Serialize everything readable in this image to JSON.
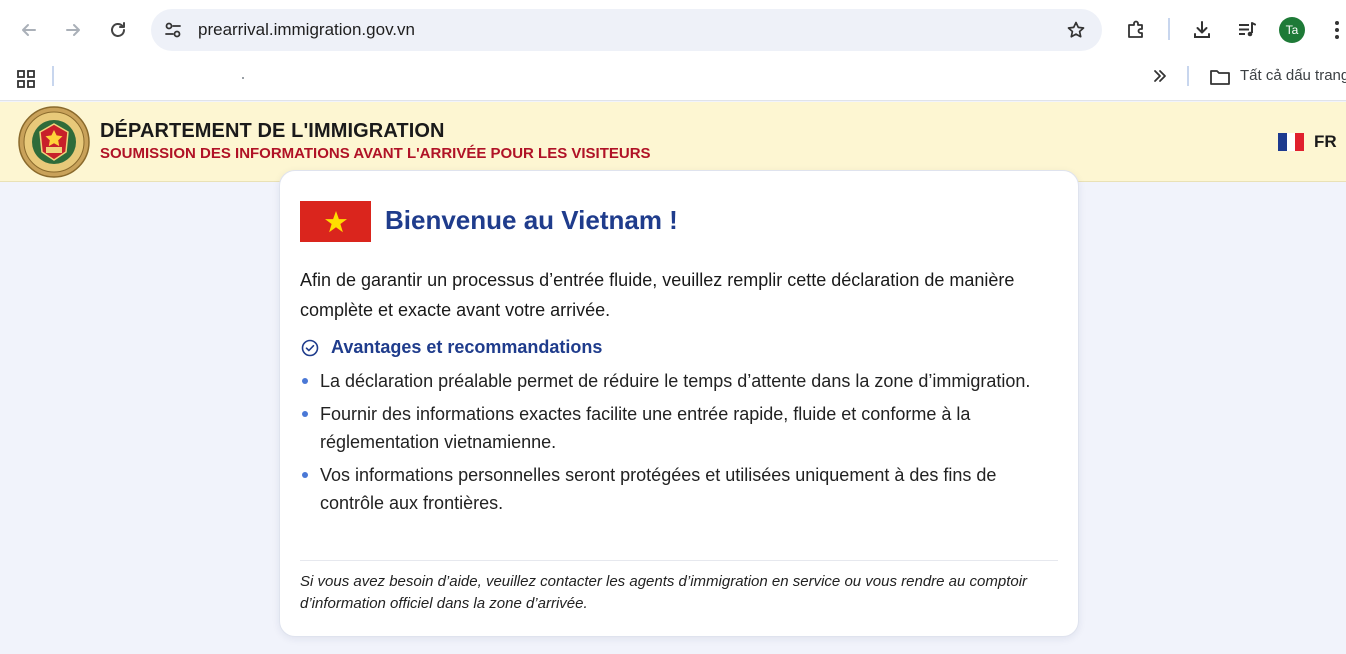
{
  "browser": {
    "url": "prearrival.immigration.gov.vn",
    "avatar_initials": "Ta",
    "bookmarks": {
      "all_bookmarks_label": "Tất cả dấu trang"
    }
  },
  "header": {
    "title": "DÉPARTEMENT DE L'IMMIGRATION",
    "subtitle": "SOUMISSION DES INFORMATIONS AVANT L'ARRIVÉE POUR LES VISITEURS",
    "language_code": "FR",
    "language_flag": "fr-flag-icon"
  },
  "card": {
    "flag_icon": "vietnam-flag-icon",
    "welcome": "Bienvenue au Vietnam !",
    "intro": "Afin de garantir un processus d’entrée fluide, veuillez remplir cette déclaration de manière complète et exacte avant votre arrivée.",
    "advantages_title": "Avantages et recommandations",
    "advantages": [
      "La déclaration préalable permet de réduire le temps d’attente dans la zone d’immigration.",
      "Fournir des informations exactes facilite une entrée rapide, fluide et conforme à la réglementation vietnamienne.",
      "Vos informations personnelles seront protégées et utilisées uniquement à des fins de contrôle aux frontières."
    ],
    "help_text": "Si vous avez besoin d’aide, veuillez contacter les agents d’immigration en service ou vous rendre au comptoir d’information officiel dans la zone d’arrivée."
  },
  "colors": {
    "header_bg": "#fdf6d2",
    "subtitle_red": "#b01226",
    "accent_blue": "#1f3c8c",
    "vn_flag_red": "#da251d",
    "vn_star_yellow": "#ffde00"
  }
}
